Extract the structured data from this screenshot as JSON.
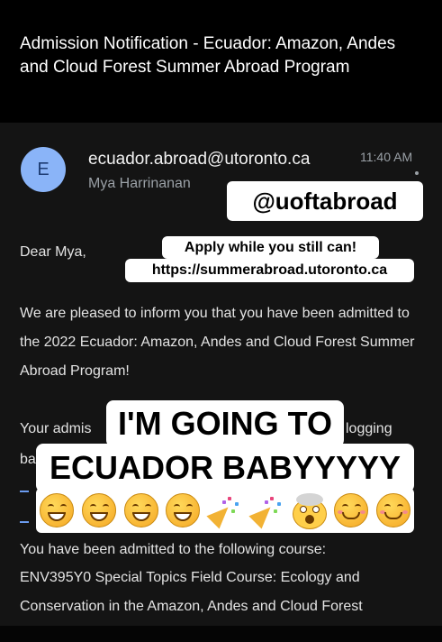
{
  "email": {
    "subject": "Admission Notification - Ecuador: Amazon, Andes and Cloud Forest Summer Abroad Program",
    "avatar_letter": "E",
    "sender": "ecuador.abroad@utoronto.ca",
    "recipient": "Mya Harrinanan",
    "time": "11:40 AM",
    "greeting": "Dear Mya,",
    "paragraph1": "We are pleased to inform you that you have been admitted to the 2022 Ecuador: Amazon, Andes and Cloud Forest Summer Abroad Program!",
    "partial_line1_start": "Your admis",
    "partial_line1_end": "logging",
    "partial_line2_start": "ba",
    "course_intro": "You have been admitted to the following course:",
    "course_line1": "ENV395Y0 Special Topics Field Course: Ecology and",
    "course_line2": "Conservation in the Amazon, Andes and Cloud Forest"
  },
  "stickers": {
    "handle": "@uoftabroad",
    "apply_line1": "Apply while you still can!",
    "apply_line2": "https://summerabroad.utoronto.ca",
    "big_line1": "I'M GOING TO",
    "big_line2": "ECUADOR BABYYYYY"
  },
  "emojis": [
    "grinning-face",
    "grinning-face",
    "grinning-face",
    "grinning-face",
    "party-popper",
    "party-popper",
    "exploding-head",
    "smiling-face",
    "smiling-face"
  ],
  "colors": {
    "background": "#000000",
    "card": "#141414",
    "avatar_bg": "#8ab4f8",
    "link": "#6b9cf0",
    "sticker_bg": "#ffffff"
  }
}
